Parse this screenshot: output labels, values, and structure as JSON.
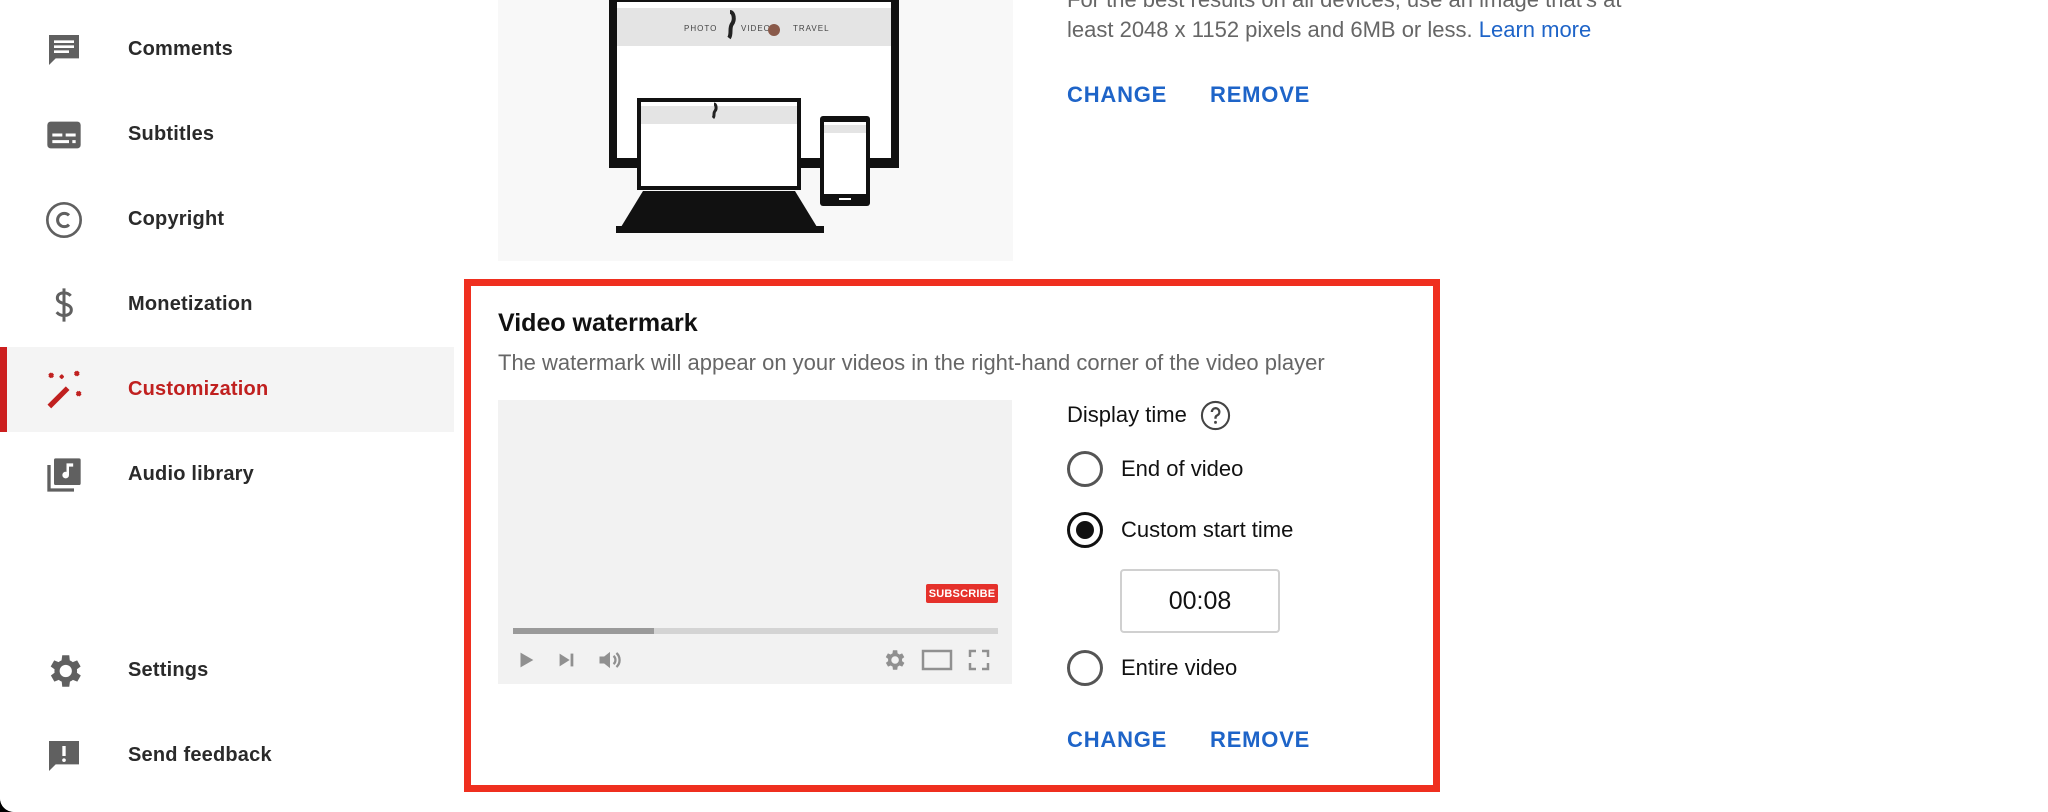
{
  "sidebar": {
    "items": [
      {
        "label": "Comments",
        "icon": "comment-icon"
      },
      {
        "label": "Subtitles",
        "icon": "subtitles-icon"
      },
      {
        "label": "Copyright",
        "icon": "copyright-icon"
      },
      {
        "label": "Monetization",
        "icon": "dollar-icon"
      },
      {
        "label": "Customization",
        "icon": "magic-wand-icon",
        "active": true
      },
      {
        "label": "Audio library",
        "icon": "audio-library-icon"
      }
    ],
    "bottom_items": [
      {
        "label": "Settings",
        "icon": "gear-icon"
      },
      {
        "label": "Send feedback",
        "icon": "feedback-icon"
      }
    ]
  },
  "banner": {
    "desc_line0": "For the best results on all devices, use an image that's at",
    "desc_line1": "least 2048 x 1152 pixels and 6MB or less.",
    "learn_more": "Learn more",
    "preview_words": [
      "PHOTO",
      "VIDEO",
      "TRAVEL"
    ],
    "change_label": "CHANGE",
    "remove_label": "REMOVE"
  },
  "watermark": {
    "title": "Video watermark",
    "description": "The watermark will appear on your videos in the right-hand corner of the video player",
    "preview": {
      "subscribe_label": "SUBSCRIBE",
      "progress_fraction": 0.29
    },
    "display_time_label": "Display time",
    "options": [
      {
        "label": "End of video",
        "checked": false
      },
      {
        "label": "Custom start time",
        "checked": true
      },
      {
        "label": "Entire video",
        "checked": false
      }
    ],
    "start_time": "00:08",
    "change_label": "CHANGE",
    "remove_label": "REMOVE"
  },
  "colors": {
    "accent_red": "#cc1f1f",
    "link_blue": "#1e64c8",
    "highlight_border": "#ef2f1f"
  }
}
